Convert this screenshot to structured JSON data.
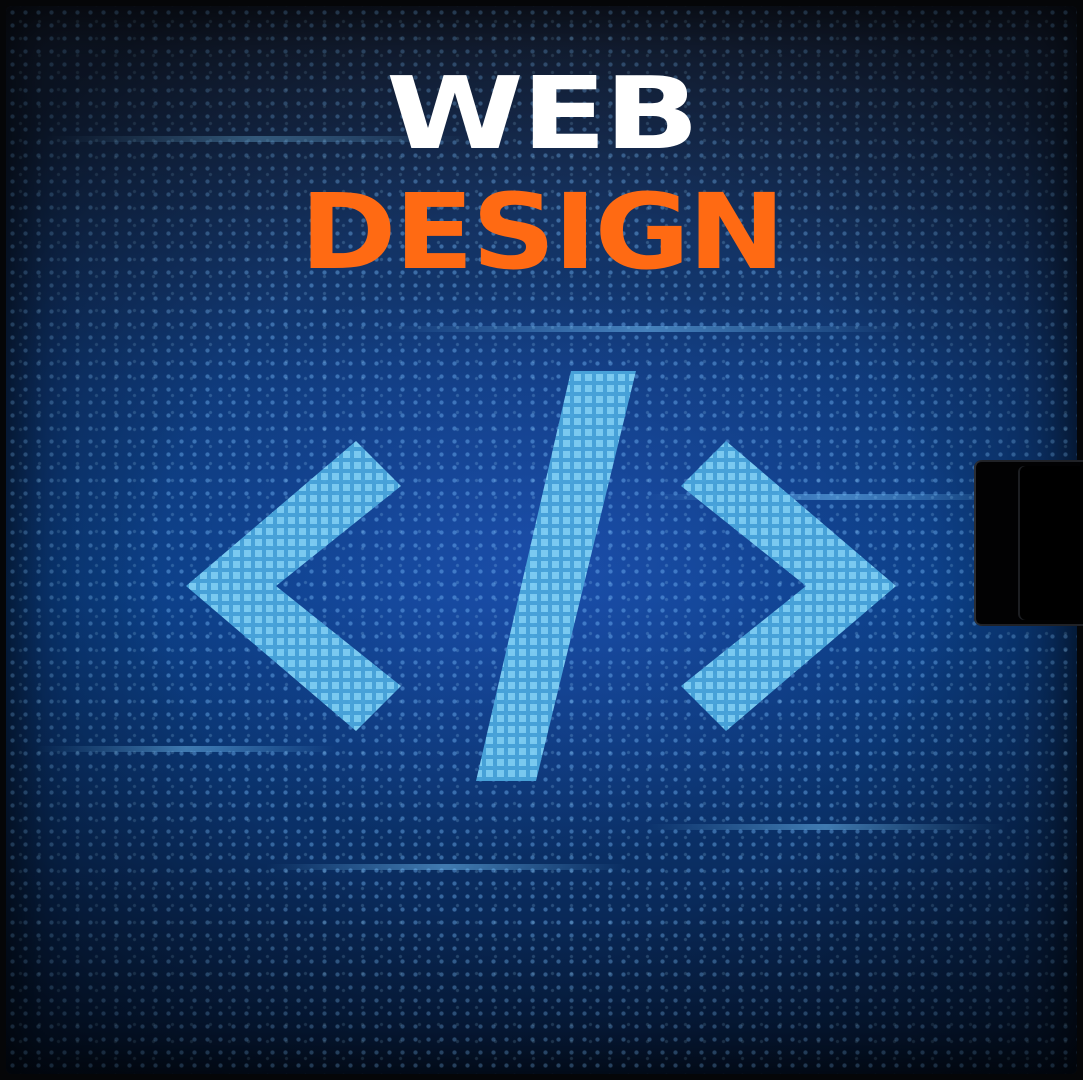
{
  "cover": {
    "title_line1": "WEB",
    "title_line2": "DESIGN",
    "icon": "code-brackets-icon"
  },
  "colors": {
    "title_line1": "#ffffff",
    "title_line2": "#ff6a13",
    "background": "#0b3f86",
    "icon": "#5fb6e8"
  }
}
